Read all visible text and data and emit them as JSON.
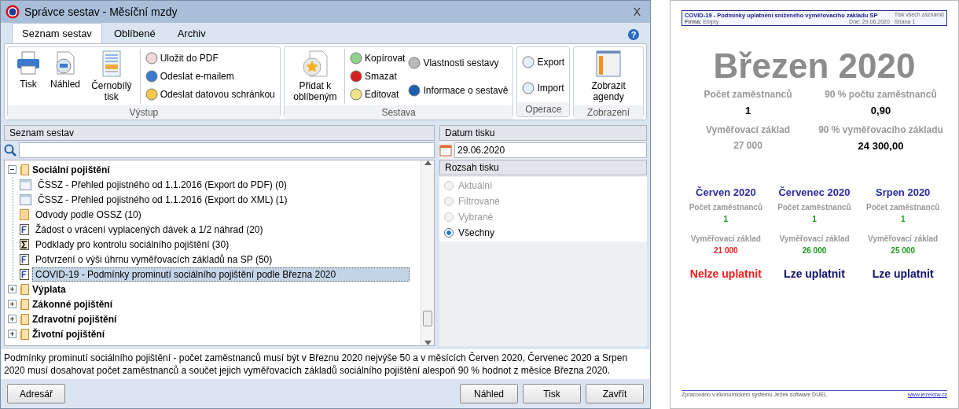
{
  "window": {
    "title": "Správce sestav - Měsíční mzdy",
    "close": "X",
    "help": "?"
  },
  "tabs": [
    {
      "label": "Seznam sestav",
      "selected": true
    },
    {
      "label": "Oblíbené",
      "selected": false
    },
    {
      "label": "Archiv",
      "selected": false
    }
  ],
  "ribbon": [
    {
      "label": "Výstup",
      "large": [
        "Tisk",
        "Náhled",
        "Černobílý tisk"
      ],
      "columns": [
        [
          "Uložit do PDF",
          "Odeslat e-mailem",
          "Odeslat datovou schránkou"
        ]
      ]
    },
    {
      "label": "Sestava",
      "large": [
        "Přidat k oblíbeným"
      ],
      "columns": [
        [
          "Kopírovat",
          "Smazat",
          "Editovat"
        ],
        [
          "Vlastnosti sestavy",
          "Informace o sestavě"
        ]
      ]
    },
    {
      "label": "Operace",
      "columns": [
        [
          "Export",
          "Import"
        ]
      ]
    },
    {
      "label": "Zobrazení",
      "large": [
        "Zobrazit agendy"
      ]
    }
  ],
  "list_panel": {
    "title": "Seznam sestav",
    "tree": [
      {
        "label": "Sociální pojištění",
        "expanded": true,
        "children": [
          {
            "label": "ČSSZ - Přehled pojistného od 1.1.2016 (Export do PDF) (0)",
            "kind": "form",
            "selected": false
          },
          {
            "label": "ČSSZ - Přehled pojistného od 1.1.2016 (Export do XML) (1)",
            "kind": "form",
            "selected": false
          },
          {
            "label": "Odvody podle OSSZ (10)",
            "kind": "folder",
            "selected": false
          },
          {
            "label": "Žádost o vrácení vyplacených dávek a 1/2 náhrad (20)",
            "kind": "f",
            "selected": false
          },
          {
            "label": "Podklady pro kontrolu sociálního pojištění (30)",
            "kind": "sigma",
            "selected": false
          },
          {
            "label": "Potvrzení o výši úhrnu vyměřovacích základů na SP (50)",
            "kind": "f",
            "selected": false
          },
          {
            "label": "COVID-19 - Podmínky prominutí sociálního pojištění podle Března 2020",
            "kind": "f",
            "selected": true
          }
        ]
      },
      {
        "label": "Výplata",
        "expanded": false
      },
      {
        "label": "Zákonné pojištění",
        "expanded": false
      },
      {
        "label": "Zdravotní pojištění",
        "expanded": false
      },
      {
        "label": "Životní pojištění",
        "expanded": false
      }
    ]
  },
  "print_date": {
    "title": "Datum tisku",
    "value": "29.06.2020"
  },
  "print_range": {
    "title": "Rozsah tisku",
    "options": [
      {
        "label": "Aktuální",
        "selected": false,
        "disabled": true
      },
      {
        "label": "Filtrované",
        "selected": false,
        "disabled": true
      },
      {
        "label": "Vybrané",
        "selected": false,
        "disabled": true
      },
      {
        "label": "Všechny",
        "selected": true,
        "disabled": false
      }
    ]
  },
  "description": "Podmínky prominutí sociálního pojištění - počet zaměstnanců musí být v Březnu 2020 nejvýše 50 a v měsících Červen 2020, Červenec 2020 a Srpen 2020 musí dosahovat počet zaměstnanců a součet jejich vyměřovacích základů sociálního pojištění alespoň 90 % hodnot z měsíce Března 2020.",
  "buttons_left": [
    "Adresář"
  ],
  "buttons_right": [
    "Náhled",
    "Tisk",
    "Zavřít"
  ],
  "preview": {
    "header": {
      "title": "COVID-19 - Podmínky uplatnění sníženého vyměřovacího základu SP",
      "scope": "Tisk všech záznamů",
      "firm_label": "Firma:",
      "firm": "Empty",
      "date": "Dne: 29.06.2020",
      "page": "Strana 1"
    },
    "heading": "Březen 2020",
    "stats": [
      {
        "label": "Počet zaměstnanců",
        "value": "1",
        "bold": true
      },
      {
        "label": "90 % počtu zaměstnanců",
        "value": "0,90",
        "bold": true
      },
      {
        "label": "Vyměřovací základ",
        "value": "27 000",
        "bold": false
      },
      {
        "label": "90 % vyměřovacího základu",
        "value": "24 300,00",
        "bold": true
      }
    ],
    "months": [
      {
        "name": "Červen 2020",
        "count_label": "Počet zaměstnanců",
        "count": "1",
        "base_label": "Vyměřovací základ",
        "base": "21 000",
        "applicable": false,
        "verdict": "Nelze uplatnit"
      },
      {
        "name": "Červenec 2020",
        "count_label": "Počet zaměstnanců",
        "count": "1",
        "base_label": "Vyměřovací základ",
        "base": "26 000",
        "applicable": true,
        "verdict": "Lze uplatnit"
      },
      {
        "name": "Srpen 2020",
        "count_label": "Počet zaměstnanců",
        "count": "1",
        "base_label": "Vyměřovací základ",
        "base": "25 000",
        "applicable": true,
        "verdict": "Lze uplatnit"
      }
    ],
    "footer": "Zpracováno v ekonomickém systému Ježek software DUEL",
    "footer_link": "www.jezeksw.cz"
  }
}
